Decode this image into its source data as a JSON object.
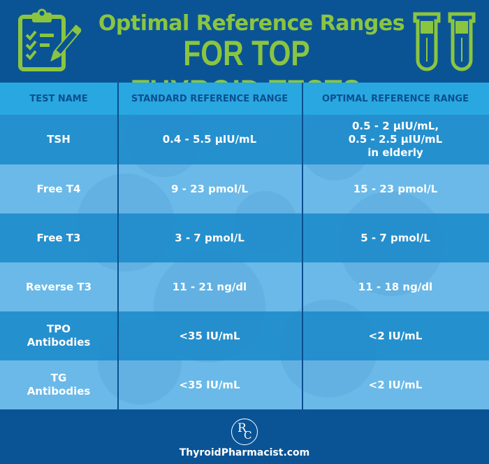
{
  "header": {
    "title_line1": "Optimal Reference Ranges",
    "title_line2": "FOR TOP THYROID TESTS",
    "left_icon": "clipboard-checklist-pencil-icon",
    "right_icon": "test-tubes-icon"
  },
  "colors": {
    "background": "#0a5496",
    "accent_green": "#8bc540",
    "header_row": "#29a7e1",
    "row_dark": "#1f8ccb",
    "row_light": "#6ab9e8",
    "divider": "#0a4f8f"
  },
  "table": {
    "columns": [
      "TEST NAME",
      "STANDARD REFERENCE RANGE",
      "OPTIMAL REFERENCE RANGE"
    ],
    "rows": [
      {
        "test": "TSH",
        "standard": "0.4 - 5.5 µIU/mL",
        "optimal": "0.5 - 2 µIU/mL,\n0.5 - 2.5 µIU/mL\nin elderly"
      },
      {
        "test": "Free T4",
        "standard": "9 - 23 pmol/L",
        "optimal": "15 - 23 pmol/L"
      },
      {
        "test": "Free T3",
        "standard": "3 - 7 pmol/L",
        "optimal": "5 - 7 pmol/L"
      },
      {
        "test": "Reverse T3",
        "standard": "11 - 21 ng/dl",
        "optimal": "11 - 18 ng/dl"
      },
      {
        "test": "TPO\nAntibodies",
        "standard": "<35 IU/mL",
        "optimal": "<2 IU/mL"
      },
      {
        "test": "TG\nAntibodies",
        "standard": "<35 IU/mL",
        "optimal": "<2 IU/mL"
      }
    ]
  },
  "footer": {
    "logo_text_r": "R",
    "logo_text_c": "C",
    "website": "ThyroidPharmacist.com"
  }
}
